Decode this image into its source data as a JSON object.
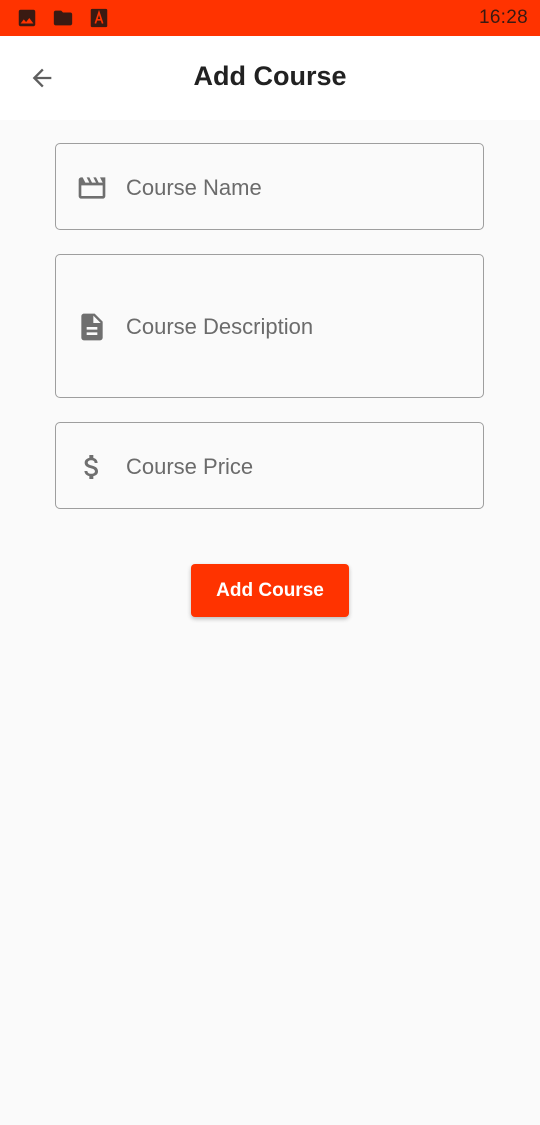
{
  "status_bar": {
    "time": "16:28",
    "background": "#ff3300",
    "notification_icons": [
      "image-icon",
      "folder-icon",
      "pdf-icon"
    ]
  },
  "app_bar": {
    "title": "Add Course",
    "back_icon": "arrow-back-icon"
  },
  "form": {
    "course_name": {
      "placeholder": "Course Name",
      "value": "",
      "icon": "movie-icon"
    },
    "course_description": {
      "placeholder": "Course Description",
      "value": "",
      "icon": "document-icon"
    },
    "course_price": {
      "placeholder": "Course Price",
      "value": "",
      "icon": "dollar-icon"
    }
  },
  "actions": {
    "add_course_label": "Add Course",
    "accent": "#ff3300"
  }
}
